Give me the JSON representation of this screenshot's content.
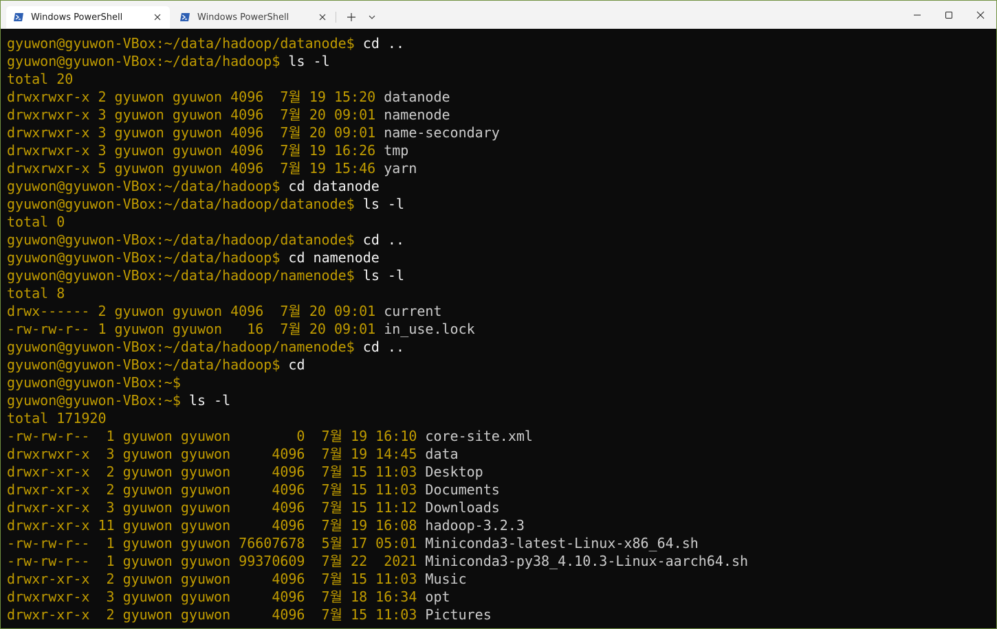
{
  "titlebar": {
    "tabs": [
      {
        "title": "Windows PowerShell",
        "active": true,
        "icon": "powershell-icon"
      },
      {
        "title": "Windows PowerShell",
        "active": false,
        "icon": "powershell-icon"
      }
    ],
    "new_tab_icon": "plus-icon",
    "dropdown_icon": "chevron-down-icon",
    "window_buttons": [
      "minimize-icon",
      "maximize-icon",
      "close-icon"
    ]
  },
  "colors": {
    "background": "#0c0c0c",
    "prompt": "#c19c00",
    "command": "#f2f2f2",
    "filename": "#cccccc",
    "window_border": "#6f8f3f"
  },
  "terminal": {
    "lines": [
      {
        "kind": "cmd",
        "prompt": "gyuwon@gyuwon-VBox:~/data/hadoop/datanode$",
        "command": " cd .."
      },
      {
        "kind": "cmd",
        "prompt": "gyuwon@gyuwon-VBox:~/data/hadoop$",
        "command": " ls -l"
      },
      {
        "kind": "text",
        "text": "total 20"
      },
      {
        "kind": "entry",
        "meta": "drwxrwxr-x 2 gyuwon gyuwon 4096  7월 19 15:20 ",
        "name": "datanode"
      },
      {
        "kind": "entry",
        "meta": "drwxrwxr-x 3 gyuwon gyuwon 4096  7월 20 09:01 ",
        "name": "namenode"
      },
      {
        "kind": "entry",
        "meta": "drwxrwxr-x 3 gyuwon gyuwon 4096  7월 20 09:01 ",
        "name": "name-secondary"
      },
      {
        "kind": "entry",
        "meta": "drwxrwxr-x 3 gyuwon gyuwon 4096  7월 19 16:26 ",
        "name": "tmp"
      },
      {
        "kind": "entry",
        "meta": "drwxrwxr-x 5 gyuwon gyuwon 4096  7월 19 15:46 ",
        "name": "yarn"
      },
      {
        "kind": "cmd",
        "prompt": "gyuwon@gyuwon-VBox:~/data/hadoop$",
        "command": " cd datanode"
      },
      {
        "kind": "cmd",
        "prompt": "gyuwon@gyuwon-VBox:~/data/hadoop/datanode$",
        "command": " ls -l"
      },
      {
        "kind": "text",
        "text": "total 0"
      },
      {
        "kind": "cmd",
        "prompt": "gyuwon@gyuwon-VBox:~/data/hadoop/datanode$",
        "command": " cd .."
      },
      {
        "kind": "cmd",
        "prompt": "gyuwon@gyuwon-VBox:~/data/hadoop$",
        "command": " cd namenode"
      },
      {
        "kind": "cmd",
        "prompt": "gyuwon@gyuwon-VBox:~/data/hadoop/namenode$",
        "command": " ls -l"
      },
      {
        "kind": "text",
        "text": "total 8"
      },
      {
        "kind": "entry",
        "meta": "drwx------ 2 gyuwon gyuwon 4096  7월 20 09:01 ",
        "name": "current"
      },
      {
        "kind": "entry",
        "meta": "-rw-rw-r-- 1 gyuwon gyuwon   16  7월 20 09:01 ",
        "name": "in_use.lock"
      },
      {
        "kind": "cmd",
        "prompt": "gyuwon@gyuwon-VBox:~/data/hadoop/namenode$",
        "command": " cd .."
      },
      {
        "kind": "cmd",
        "prompt": "gyuwon@gyuwon-VBox:~/data/hadoop$",
        "command": " cd"
      },
      {
        "kind": "cmd",
        "prompt": "gyuwon@gyuwon-VBox:~$",
        "command": ""
      },
      {
        "kind": "cmd",
        "prompt": "gyuwon@gyuwon-VBox:~$",
        "command": " ls -l"
      },
      {
        "kind": "text",
        "text": "total 171920"
      },
      {
        "kind": "entry",
        "meta": "-rw-rw-r--  1 gyuwon gyuwon        0  7월 19 16:10 ",
        "name": "core-site.xml"
      },
      {
        "kind": "entry",
        "meta": "drwxrwxr-x  3 gyuwon gyuwon     4096  7월 19 14:45 ",
        "name": "data"
      },
      {
        "kind": "entry",
        "meta": "drwxr-xr-x  2 gyuwon gyuwon     4096  7월 15 11:03 ",
        "name": "Desktop"
      },
      {
        "kind": "entry",
        "meta": "drwxr-xr-x  2 gyuwon gyuwon     4096  7월 15 11:03 ",
        "name": "Documents"
      },
      {
        "kind": "entry",
        "meta": "drwxr-xr-x  3 gyuwon gyuwon     4096  7월 15 11:12 ",
        "name": "Downloads"
      },
      {
        "kind": "entry",
        "meta": "drwxr-xr-x 11 gyuwon gyuwon     4096  7월 19 16:08 ",
        "name": "hadoop-3.2.3"
      },
      {
        "kind": "entry",
        "meta": "-rw-rw-r--  1 gyuwon gyuwon 76607678  5월 17 05:01 ",
        "name": "Miniconda3-latest-Linux-x86_64.sh"
      },
      {
        "kind": "entry",
        "meta": "-rw-rw-r--  1 gyuwon gyuwon 99370609  7월 22  2021 ",
        "name": "Miniconda3-py38_4.10.3-Linux-aarch64.sh"
      },
      {
        "kind": "entry",
        "meta": "drwxr-xr-x  2 gyuwon gyuwon     4096  7월 15 11:03 ",
        "name": "Music"
      },
      {
        "kind": "entry",
        "meta": "drwxrwxr-x  3 gyuwon gyuwon     4096  7월 18 16:34 ",
        "name": "opt"
      },
      {
        "kind": "entry",
        "meta": "drwxr-xr-x  2 gyuwon gyuwon     4096  7월 15 11:03 ",
        "name": "Pictures"
      }
    ]
  }
}
